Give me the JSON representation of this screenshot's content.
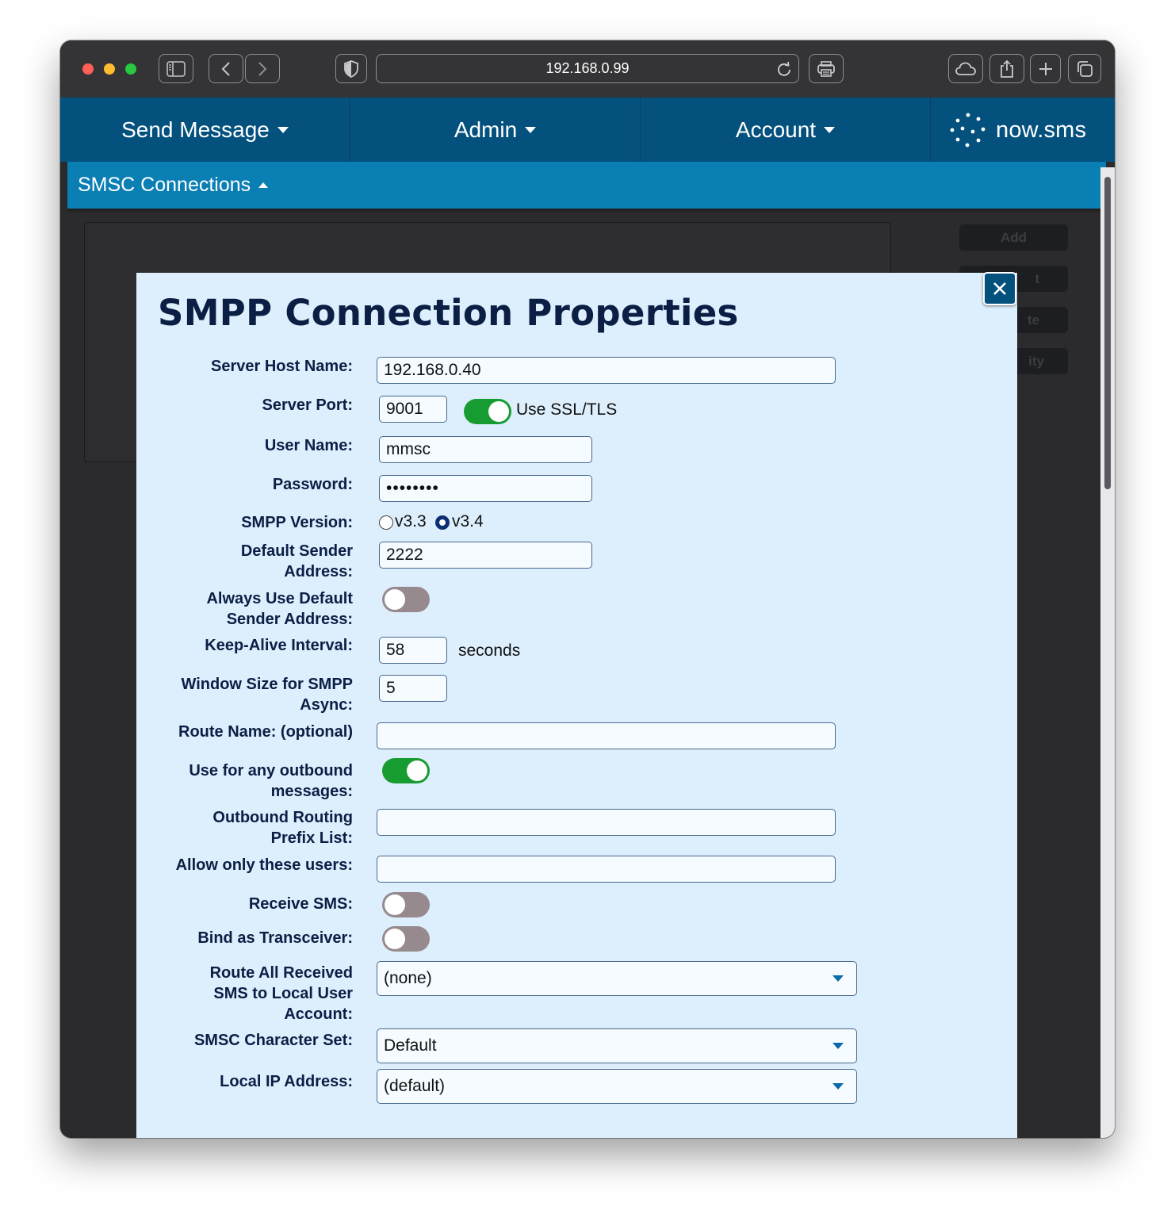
{
  "browser": {
    "url": "192.168.0.99"
  },
  "nav": {
    "items": [
      {
        "label": "Send Message"
      },
      {
        "label": "Admin"
      },
      {
        "label": "Account"
      }
    ],
    "logo_text": "now.sms"
  },
  "subheader": {
    "title": "SMSC Connections"
  },
  "background": {
    "buttons": [
      "Add",
      "t",
      "te",
      "ity"
    ]
  },
  "modal": {
    "title": "SMPP Connection Properties",
    "fields": {
      "server_host": {
        "label": "Server Host Name:",
        "value": "192.168.0.40"
      },
      "server_port": {
        "label": "Server Port:",
        "value": "9001",
        "ssl_label": "Use SSL/TLS",
        "ssl_enabled": true
      },
      "user_name": {
        "label": "User Name:",
        "value": "mmsc"
      },
      "password": {
        "label": "Password:",
        "value": "••••••••"
      },
      "smpp_version": {
        "label": "SMPP Version:",
        "options": [
          "v3.3",
          "v3.4"
        ],
        "selected": "v3.4"
      },
      "default_sender": {
        "label": "Default Sender\nAddress:",
        "value": "2222"
      },
      "always_default_sender": {
        "label": "Always Use Default\nSender Address:",
        "enabled": false
      },
      "keep_alive": {
        "label": "Keep-Alive Interval:",
        "value": "58",
        "unit": "seconds"
      },
      "window_size": {
        "label": "Window Size for SMPP\nAsync:",
        "value": "5"
      },
      "route_name": {
        "label": "Route Name: (optional)",
        "value": ""
      },
      "use_outbound": {
        "label": "Use for any outbound\nmessages:",
        "enabled": true
      },
      "routing_prefix": {
        "label": "Outbound Routing\nPrefix List:",
        "value": ""
      },
      "allow_users": {
        "label": "Allow only these users:",
        "value": ""
      },
      "receive_sms": {
        "label": "Receive SMS:",
        "enabled": false
      },
      "bind_transceiver": {
        "label": "Bind as Transceiver:",
        "enabled": false
      },
      "route_received": {
        "label": "Route All Received\nSMS to Local User\nAccount:",
        "value": "(none)"
      },
      "charset": {
        "label": "SMSC Character Set:",
        "value": "Default"
      },
      "local_ip": {
        "label": "Local IP Address:",
        "value": "(default)"
      }
    }
  },
  "colors": {
    "nav": "#04517e",
    "subheader": "#0a7fb4",
    "modal_bg": "#ddeefc",
    "toggle_on": "#179c32",
    "toggle_off": "#978a8e",
    "title": "#0b1f45"
  }
}
